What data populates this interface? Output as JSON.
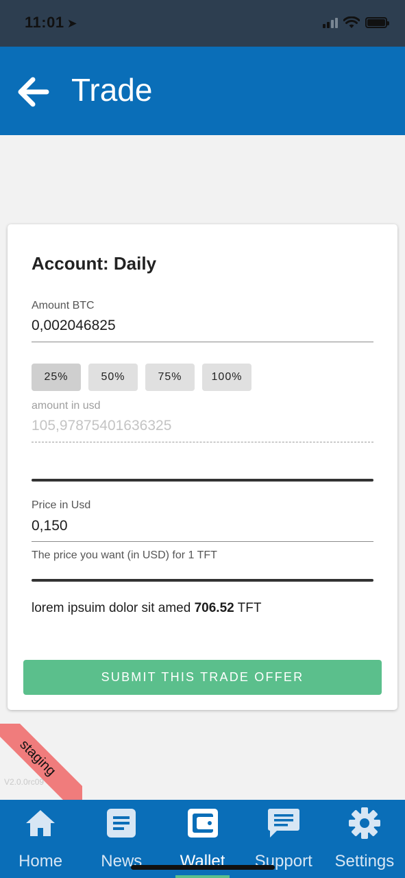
{
  "status_bar": {
    "time": "11:01",
    "location_icon": "location-arrow-icon",
    "icons": [
      "signal-icon",
      "wifi-icon",
      "battery-icon"
    ]
  },
  "header": {
    "title": "Trade",
    "back_icon": "arrow-left-icon"
  },
  "form": {
    "account_title": "Account: Daily",
    "amount_label": "Amount BTC",
    "amount_value": "0,002046825",
    "percent_buttons": [
      "25%",
      "50%",
      "75%",
      "100%"
    ],
    "usd_label": "amount in usd",
    "usd_value": "105,97875401636325",
    "price_label": "Price in Usd",
    "price_value": "0,150",
    "price_helper": "The price you want (in USD) for 1 TFT",
    "summary_prefix": "lorem ipsuim dolor sit amed",
    "summary_amount": "706.52",
    "summary_unit": "TFT",
    "submit_label": "SUBMIT THIS TRADE OFFER"
  },
  "badge": {
    "ribbon": "staging",
    "version": "V2.0.0rc09"
  },
  "nav": {
    "items": [
      {
        "label": "Home",
        "icon": "home-icon"
      },
      {
        "label": "News",
        "icon": "news-icon"
      },
      {
        "label": "Wallet",
        "icon": "wallet-icon"
      },
      {
        "label": "Support",
        "icon": "chat-icon"
      },
      {
        "label": "Settings",
        "icon": "gear-icon"
      }
    ],
    "active": "Wallet"
  },
  "colors": {
    "primary": "#0a6eb8",
    "status_bar": "#2d3e50",
    "submit": "#5bbf8c",
    "ribbon": "#f07c7c"
  }
}
